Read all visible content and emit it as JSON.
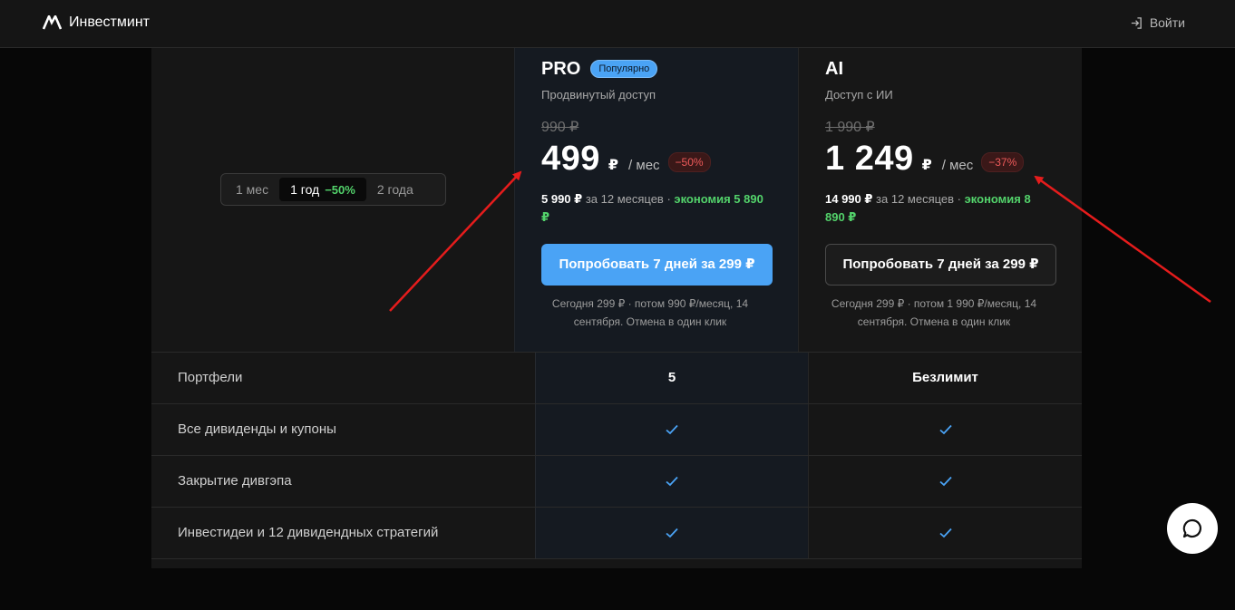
{
  "header": {
    "brand": "Инвестминт",
    "login_label": "Войти"
  },
  "toggle": {
    "items": [
      {
        "label": "1 мес",
        "discount": ""
      },
      {
        "label": "1 год",
        "discount": "−50%"
      },
      {
        "label": "2 года",
        "discount": ""
      }
    ],
    "selected": "1 год"
  },
  "plans": {
    "pro": {
      "name": "PRO",
      "badge": "Популярно",
      "subtitle": "Продвинутый доступ",
      "old_price": "990 ₽",
      "price": "499",
      "currency": "₽",
      "per": "/ мес",
      "discount": "−50%",
      "year_total": "5 990 ₽",
      "year_text": " за 12 месяцев · ",
      "savings_label": "экономия",
      "savings_value": "5 890 ₽",
      "cta": "Попробовать 7 дней за 299 ₽",
      "note": "Сегодня 299 ₽ · потом 990 ₽/месяц, 14 сентября. Отмена в один клик"
    },
    "ai": {
      "name": "AI",
      "subtitle": "Доступ с ИИ",
      "old_price": "1 990 ₽",
      "price": "1 249",
      "currency": "₽",
      "per": "/ мес",
      "discount": "−37%",
      "year_total": "14 990 ₽",
      "year_text": " за 12 месяцев · ",
      "savings_label": "экономия",
      "savings_value": "8 890 ₽",
      "cta": "Попробовать 7 дней за 299 ₽",
      "note": "Сегодня 299 ₽ · потом 1 990 ₽/месяц, 14 сентября. Отмена в один клик"
    }
  },
  "features": [
    {
      "label": "Портфели",
      "pro": "5",
      "ai": "Безлимит"
    },
    {
      "label": "Все дивиденды и купоны",
      "pro": "check",
      "ai": "check"
    },
    {
      "label": "Закрытие дивгэпа",
      "pro": "check",
      "ai": "check"
    },
    {
      "label": "Инвестидеи и 12 дивидендных стратегий",
      "pro": "check",
      "ai": "check"
    }
  ],
  "colors": {
    "accent_blue": "#4aa3f5",
    "savings_green": "#53d36b",
    "discount_red": "#ef5a5a",
    "annotation_arrow": "#e51c1c"
  },
  "icons": {
    "logo": "logo-mark-icon",
    "login": "login-arrow-icon",
    "check": "check-icon",
    "chat": "chat-bubble-icon"
  }
}
